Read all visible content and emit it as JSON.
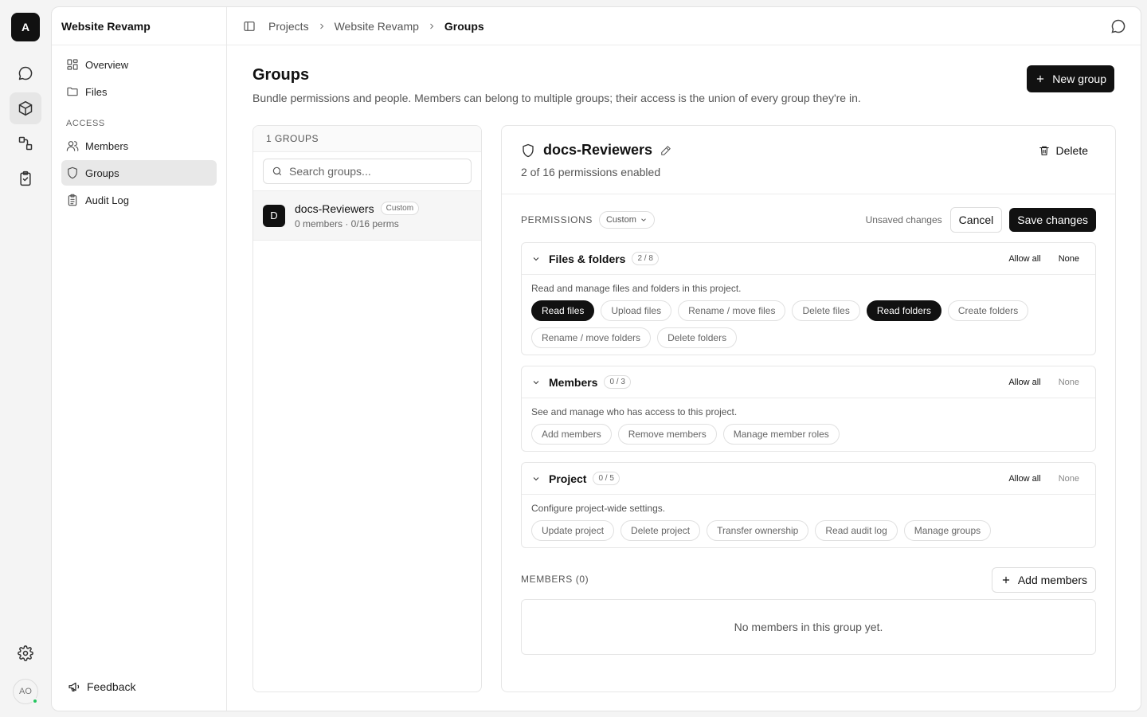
{
  "rail": {
    "logo_letter": "A",
    "items": [
      {
        "icon": "chat-icon"
      },
      {
        "icon": "cube-icon"
      },
      {
        "icon": "workflow-icon"
      },
      {
        "icon": "clipboard-check-icon"
      }
    ],
    "avatar_initials": "AO",
    "status_color": "#22c55e"
  },
  "sidebar": {
    "project_name": "Website Revamp",
    "nav": [
      {
        "label": "Overview",
        "icon": "grid-icon"
      },
      {
        "label": "Files",
        "icon": "folder-icon"
      }
    ],
    "access_section": "ACCESS",
    "access": [
      {
        "label": "Members",
        "icon": "users-icon"
      },
      {
        "label": "Groups",
        "icon": "shield-icon"
      },
      {
        "label": "Audit Log",
        "icon": "clipboard-list-icon"
      }
    ],
    "feedback_label": "Feedback"
  },
  "breadcrumb": {
    "items": [
      "Projects",
      "Website Revamp",
      "Groups"
    ]
  },
  "page": {
    "title": "Groups",
    "description": "Bundle permissions and people. Members can belong to multiple groups; their access is the union of every group they're in.",
    "new_group_label": "New group"
  },
  "groups_list": {
    "header": "1 GROUPS",
    "search_placeholder": "Search groups...",
    "groups": [
      {
        "initial": "D",
        "name": "docs-Reviewers",
        "tag": "Custom",
        "meta": "0 members · 0/16 perms"
      }
    ]
  },
  "detail": {
    "name": "docs-Reviewers",
    "subtitle": "2 of 16 permissions enabled",
    "delete_label": "Delete",
    "permissions_label": "PERMISSIONS",
    "preset_label": "Custom",
    "unsaved_label": "Unsaved changes",
    "cancel_label": "Cancel",
    "save_label": "Save changes",
    "allow_all_label": "Allow all",
    "none_label": "None",
    "groups": [
      {
        "name": "Files & folders",
        "count": "2 / 8",
        "description": "Read and manage files and folders in this project.",
        "perms": [
          {
            "label": "Read files",
            "on": true
          },
          {
            "label": "Upload files",
            "on": false
          },
          {
            "label": "Rename / move files",
            "on": false
          },
          {
            "label": "Delete files",
            "on": false
          },
          {
            "label": "Read folders",
            "on": true
          },
          {
            "label": "Create folders",
            "on": false
          },
          {
            "label": "Rename / move folders",
            "on": false
          },
          {
            "label": "Delete folders",
            "on": false
          }
        ]
      },
      {
        "name": "Members",
        "count": "0 / 3",
        "description": "See and manage who has access to this project.",
        "perms": [
          {
            "label": "Add members",
            "on": false
          },
          {
            "label": "Remove members",
            "on": false
          },
          {
            "label": "Manage member roles",
            "on": false
          }
        ]
      },
      {
        "name": "Project",
        "count": "0 / 5",
        "description": "Configure project-wide settings.",
        "perms": [
          {
            "label": "Update project",
            "on": false
          },
          {
            "label": "Delete project",
            "on": false
          },
          {
            "label": "Transfer ownership",
            "on": false
          },
          {
            "label": "Read audit log",
            "on": false
          },
          {
            "label": "Manage groups",
            "on": false
          }
        ]
      }
    ],
    "members_label": "MEMBERS (0)",
    "add_members_label": "Add members",
    "members_empty": "No members in this group yet."
  }
}
